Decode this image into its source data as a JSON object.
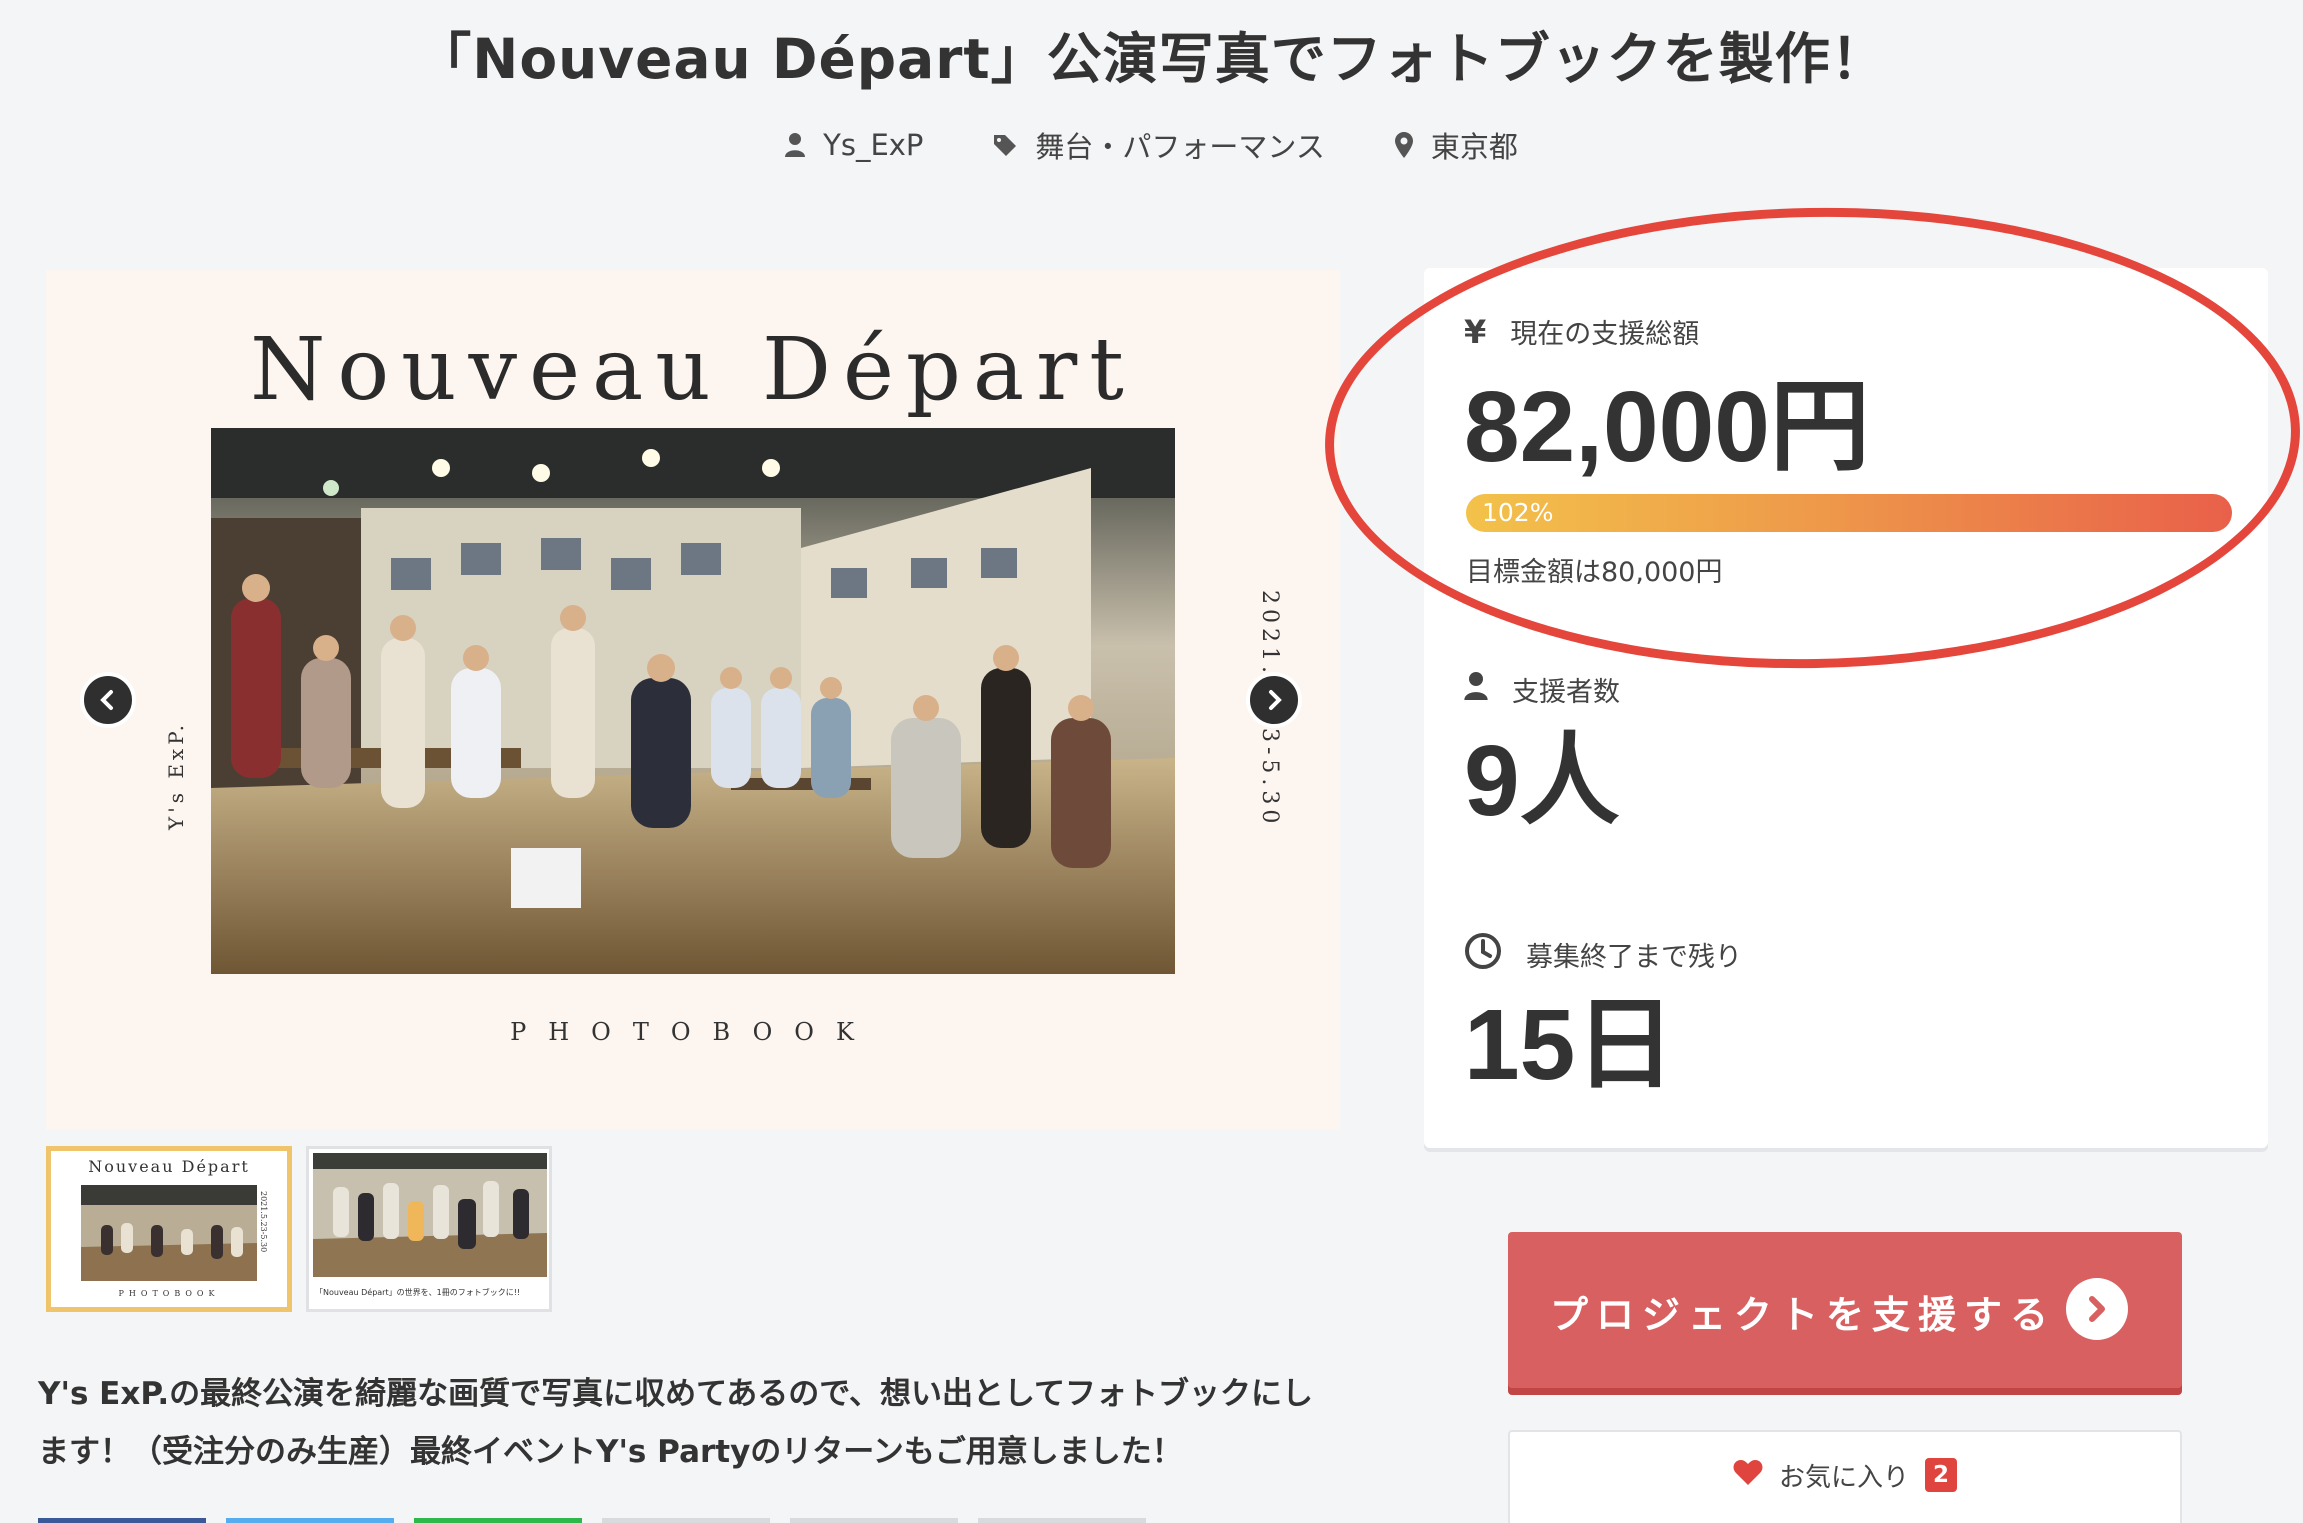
{
  "page": {
    "title": "「Nouveau Départ」公演写真でフォトブックを製作！",
    "owner": "Ys_ExP",
    "category": "舞台・パフォーマンス",
    "location": "東京都"
  },
  "hero": {
    "title": "Nouveau Départ",
    "subtitle": "PHOTOBOOK",
    "side_left": "Y's ExP.",
    "side_right": "2021.5.23-5.30"
  },
  "thumbnails": {
    "thumb1_title": "Nouveau Départ",
    "thumb1_date": "2021.5.23-5.30",
    "thumb1_sub": "PHOTOBOOK",
    "thumb2_caption": "「Nouveau Départ」の世界を、1冊のフォトブックに!!"
  },
  "description": {
    "line1": "Y's ExP.の最終公演を綺麗な画質で写真に収めてあるので、想い出としてフォトブックにし",
    "line2": "ます！（受注分のみ生産）最終イベントY's Partyのリターンもご用意しました！"
  },
  "stats": {
    "total_label": "現在の支援総額",
    "total_value": "82,000円",
    "progress_percent": 102,
    "progress_label": "102%",
    "goal_text": "目標金額は80,000円",
    "supporters_label": "支援者数",
    "supporters_value": "9人",
    "remaining_label": "募集終了まで残り",
    "remaining_value": "15日"
  },
  "actions": {
    "support_label": "プロジェクトを支援する",
    "favorite_label": "お気に入り",
    "favorite_count": "2"
  },
  "colors": {
    "background": "#f4f5f7",
    "accent_red": "#d86060",
    "highlight_ring": "#e5463c",
    "progress_start": "#f3c24a",
    "progress_end": "#e9604a",
    "thumb_active_border": "#efc46a"
  }
}
